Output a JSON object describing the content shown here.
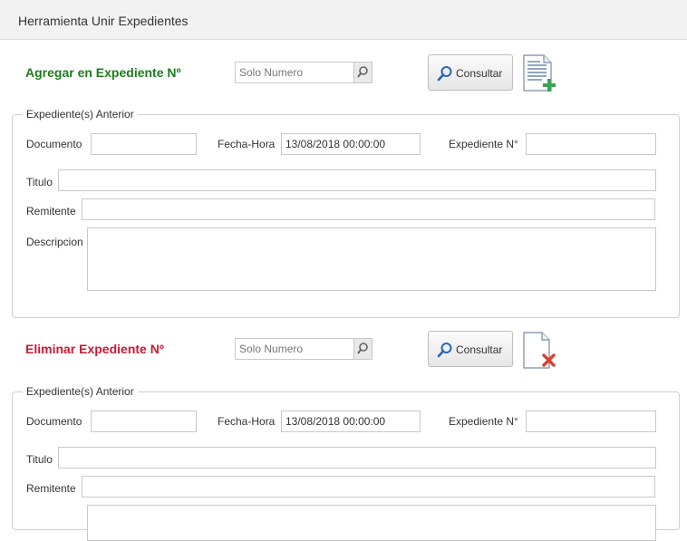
{
  "window": {
    "title": "Herramienta Unir Expedientes"
  },
  "add_section": {
    "title": "Agregar en Expediente Nº",
    "search_placeholder": "Solo Numero",
    "consult_label": "Consultar",
    "group": {
      "legend": "Expediente(s) Anterior",
      "documento_label": "Documento",
      "documento_value": "",
      "fecha_label": "Fecha-Hora",
      "fecha_value": "13/08/2018 00:00:00",
      "expediente_label": "Expediente N°",
      "expediente_value": "",
      "titulo_label": "Titulo",
      "remitente_label": "Remitente",
      "descripcion_label": "Descripcion"
    }
  },
  "remove_section": {
    "title": "Eliminar Expediente Nº",
    "search_placeholder": "Solo Numero",
    "consult_label": "Consultar",
    "group": {
      "legend": "Expediente(s) Anterior",
      "documento_label": "Documento",
      "documento_value": "",
      "fecha_label": "Fecha-Hora",
      "fecha_value": "13/08/2018 00:00:00",
      "expediente_label": "Expediente N°",
      "expediente_value": "",
      "titulo_label": "Titulo",
      "remitente_label": "Remitente"
    }
  },
  "colors": {
    "add_title": "#1e7b1e",
    "remove_title": "#d0162f",
    "add_icon_plus": "#3aa35a",
    "remove_icon_x": "#d9412f"
  },
  "icons": {
    "search": "magnifier-icon",
    "add_doc": "document-add-icon",
    "remove_doc": "document-remove-icon"
  }
}
